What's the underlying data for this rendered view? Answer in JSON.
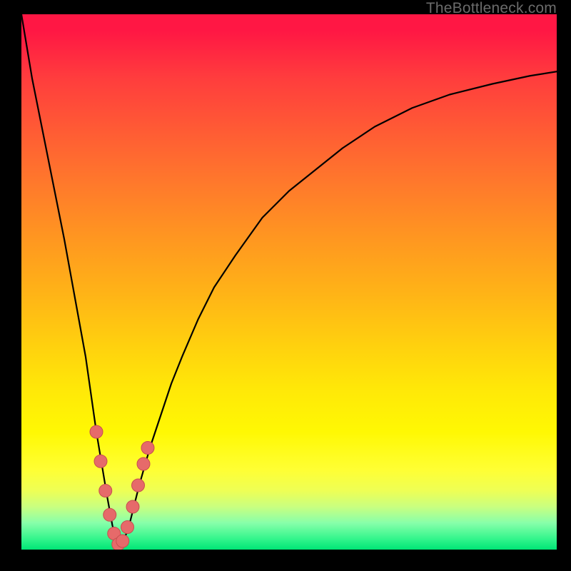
{
  "watermark": "TheBottleneck.com",
  "colors": {
    "background": "#000000",
    "curve": "#000000",
    "marker_fill": "#E66A6A",
    "marker_stroke": "#C74F4F",
    "gradient_top": "#FF1744",
    "gradient_bottom": "#00E676"
  },
  "chart_data": {
    "type": "line",
    "title": "",
    "xlabel": "",
    "ylabel": "",
    "xlim": [
      0,
      100
    ],
    "ylim": [
      0,
      100
    ],
    "grid": false,
    "legend": false,
    "note": "Axes have no tick labels in the source image; values are inferred on a 0–100 scale. y represents a bottleneck-style metric where 0 is optimal (green band) and 100 is worst (red band). The curve has a sharp minimum near x≈18.",
    "series": [
      {
        "name": "curve",
        "x": [
          0,
          2,
          4,
          6,
          8,
          10,
          12,
          14,
          15,
          16,
          17,
          18,
          19,
          20,
          21,
          22,
          24,
          26,
          28,
          30,
          33,
          36,
          40,
          45,
          50,
          55,
          60,
          66,
          73,
          80,
          88,
          95,
          100
        ],
        "y": [
          100,
          88,
          78,
          68,
          58,
          47,
          36,
          22,
          16,
          10,
          4.5,
          1,
          1.5,
          4,
          8,
          12,
          19,
          25,
          31,
          36,
          43,
          49,
          55,
          62,
          67,
          71,
          75,
          79,
          82.5,
          85,
          87,
          88.5,
          89.3
        ]
      }
    ],
    "markers": {
      "name": "highlighted-points",
      "shape": "circle",
      "x": [
        14.0,
        14.8,
        15.7,
        16.5,
        17.3,
        18.1,
        18.9,
        19.8,
        20.8,
        21.8,
        22.8,
        23.6
      ],
      "y": [
        22.0,
        16.5,
        11.0,
        6.5,
        3.0,
        1.0,
        1.6,
        4.2,
        8.0,
        12.0,
        16.0,
        19.0
      ]
    }
  }
}
